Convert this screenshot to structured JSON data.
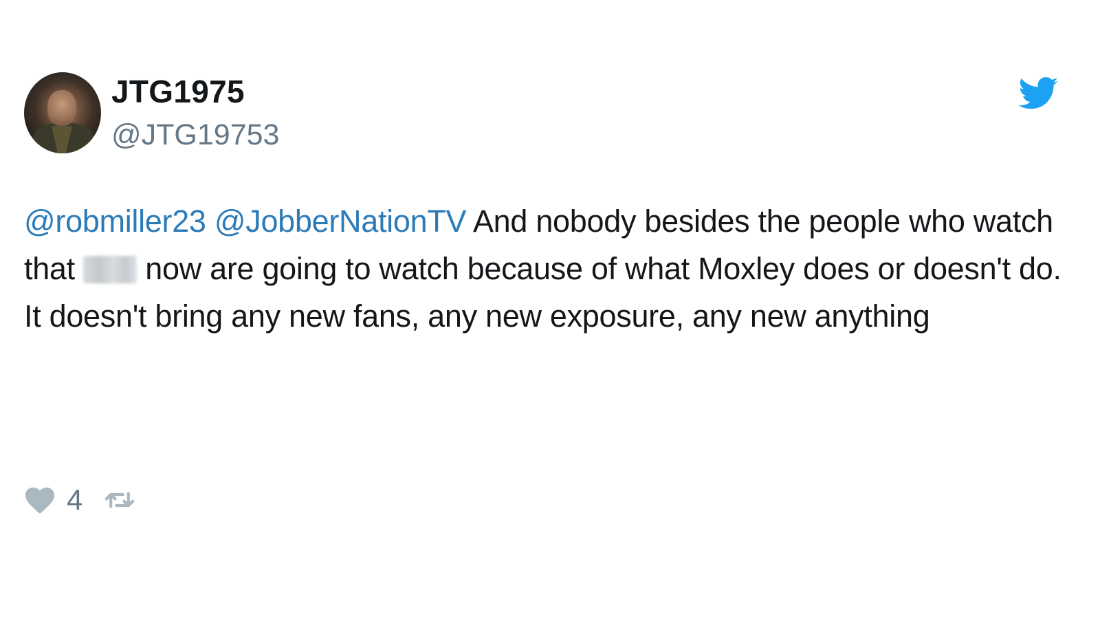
{
  "author": {
    "display_name": "JTG1975",
    "handle": "@JTG19753"
  },
  "tweet": {
    "mention_1": "@robmiller23",
    "mention_2": "@JobberNationTV",
    "text_part_1": " And nobody besides the people who watch that ",
    "text_part_2": " now are going to watch because of what Moxley does or doesn't do. It doesn't bring any new fans, any new exposure, any new anything"
  },
  "actions": {
    "like_count": "4"
  },
  "icons": {
    "logo": "twitter-bird-icon",
    "like": "heart-icon",
    "retweet": "retweet-icon"
  },
  "colors": {
    "mention": "#2b7bb9",
    "twitter_blue": "#1da1f2",
    "secondary_text": "#657786",
    "icon_gray": "#aab8c2"
  }
}
